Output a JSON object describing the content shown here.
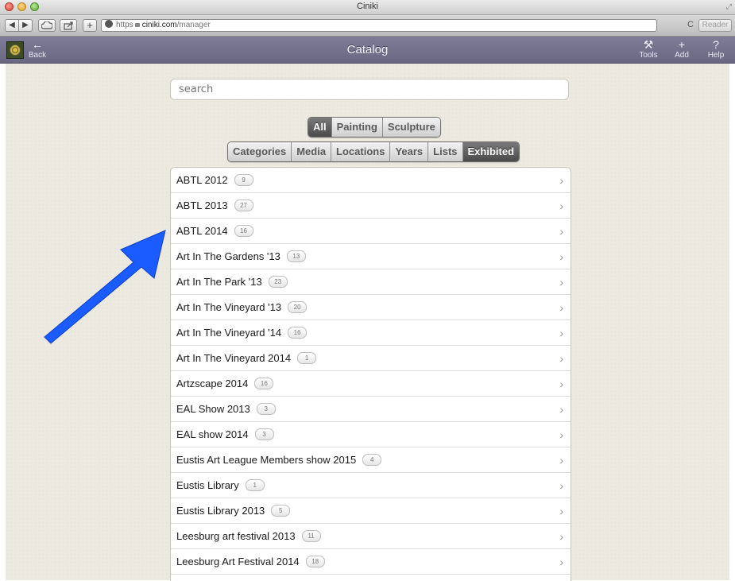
{
  "window": {
    "title": "Ciniki"
  },
  "browser": {
    "back_icon": "◀",
    "forward_icon": "▶",
    "url_scheme": "https",
    "url_host": "ciniki.com",
    "url_path": "/manager",
    "reader_label": "Reader",
    "reload_icon": "C"
  },
  "appbar": {
    "title": "Catalog",
    "back_label": "Back",
    "tools_label": "Tools",
    "add_label": "Add",
    "help_label": "Help"
  },
  "search": {
    "placeholder": "search"
  },
  "type_tabs": [
    {
      "label": "All",
      "active": true
    },
    {
      "label": "Painting",
      "active": false
    },
    {
      "label": "Sculpture",
      "active": false
    }
  ],
  "facet_tabs": [
    {
      "label": "Categories",
      "active": false
    },
    {
      "label": "Media",
      "active": false
    },
    {
      "label": "Locations",
      "active": false
    },
    {
      "label": "Years",
      "active": false
    },
    {
      "label": "Lists",
      "active": false
    },
    {
      "label": "Exhibited",
      "active": true
    }
  ],
  "exhibitions": [
    {
      "name": "ABTL 2012",
      "count": "9"
    },
    {
      "name": "ABTL 2013",
      "count": "27"
    },
    {
      "name": "ABTL 2014",
      "count": "16"
    },
    {
      "name": "Art In The Gardens '13",
      "count": "13"
    },
    {
      "name": "Art In The Park '13",
      "count": "23"
    },
    {
      "name": "Art In The Vineyard '13",
      "count": "20"
    },
    {
      "name": "Art In The Vineyard '14",
      "count": "16"
    },
    {
      "name": "Art In The Vineyard 2014",
      "count": "1"
    },
    {
      "name": "Artzscape 2014",
      "count": "16"
    },
    {
      "name": "EAL Show 2013",
      "count": "3"
    },
    {
      "name": "EAL show 2014",
      "count": "3"
    },
    {
      "name": "Eustis Art League Members show 2015",
      "count": "4"
    },
    {
      "name": "Eustis Library",
      "count": "1"
    },
    {
      "name": "Eustis Library 2013",
      "count": "5"
    },
    {
      "name": "Leesburg art festival 2013",
      "count": "11"
    },
    {
      "name": "Leesburg Art Festival 2014",
      "count": "18"
    }
  ],
  "colors": {
    "app_header": "#75728d",
    "page_background": "#ece9e1",
    "annotation_arrow": "#1a5cff",
    "active_tab": "#5a5a5a"
  },
  "icons": {
    "back": "left-arrow-icon",
    "tools": "wrench-icon",
    "add": "plus-icon",
    "help": "question-icon",
    "chevron": "chevron-right-icon"
  }
}
